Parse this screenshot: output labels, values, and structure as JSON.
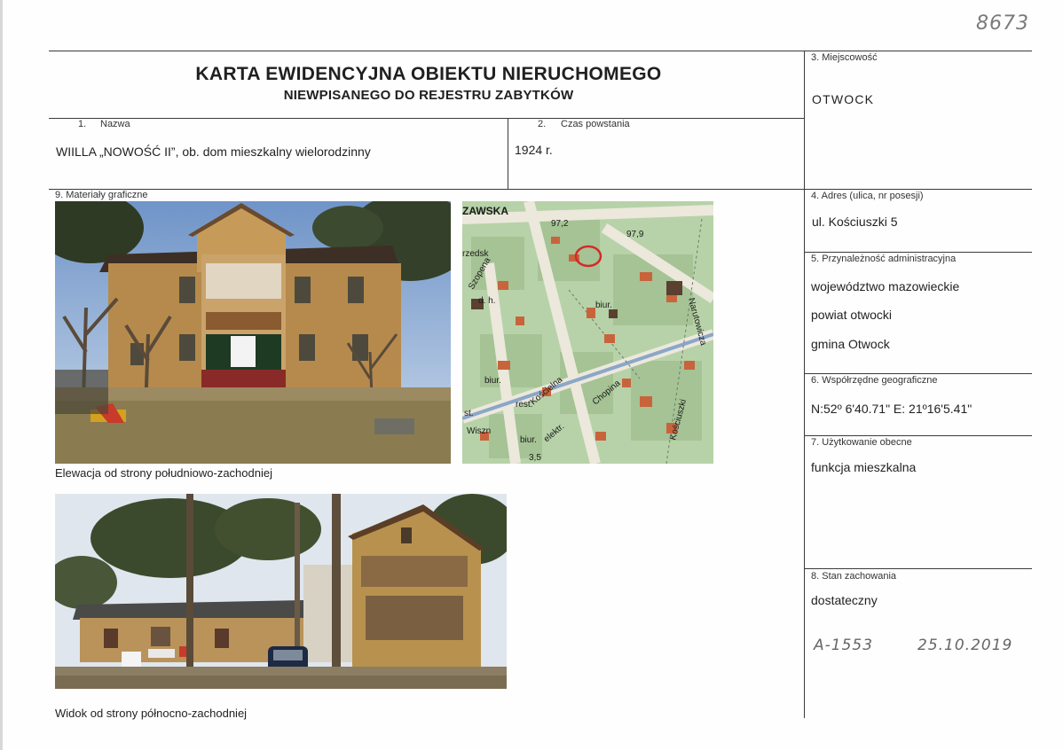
{
  "document": {
    "inventory_number": "8673",
    "title_line1": "KARTA EWIDENCYJNA OBIEKTU NIERUCHOMEGO",
    "title_line2": "NIEWPISANEGO DO REJESTRU ZABYTKÓW"
  },
  "fields": {
    "name": {
      "label": "Nazwa",
      "number": "1.",
      "value": "WIILLA „NOWOŚĆ II”, ob. dom mieszkalny wielorodzinny"
    },
    "created": {
      "label": "Czas powstania",
      "number": "2.",
      "value": "1924 r."
    },
    "locality": {
      "label": "3. Miejscowość",
      "value": "OTWOCK"
    },
    "address": {
      "label": "4. Adres (ulica, nr posesji)",
      "value": "ul. Kościuszki 5"
    },
    "admin": {
      "label": "5. Przynależność administracyjna",
      "voivodeship": "województwo mazowieckie",
      "county": "powiat otwocki",
      "commune": "gmina Otwock"
    },
    "coords": {
      "label": "6. Współrzędne geograficzne",
      "value": "N:52º 6'40.71\" E: 21º16'5.41\""
    },
    "usage": {
      "label": "7. Użytkowanie obecne",
      "value": "funkcja mieszkalna"
    },
    "condition": {
      "label": "8. Stan zachowania",
      "value": "dostateczny"
    },
    "graphics": {
      "label": "9. Materiały graficzne"
    }
  },
  "captions": {
    "photo1": "Elewacja od strony południowo-zachodniej",
    "photo2": "Widok od strony północno-zachodniej"
  },
  "map": {
    "labels": [
      "ZAWSKA",
      "97,2",
      "97,9",
      "rzedsk",
      "Szopena",
      "d. h.",
      "biur.",
      "Kościelna",
      "Chopina",
      "biur.",
      "Kościuszki",
      "rest.",
      "biur.",
      "elektr.",
      "3,5",
      "st.",
      "Wiszn",
      "Narutowicza"
    ]
  },
  "handwritten": {
    "reg_number": "A-1553",
    "date": "25.10.2019"
  },
  "colors": {
    "lines": "#3a3a3a",
    "map_green": "#a9c89a",
    "map_road": "#e9e4d8",
    "map_building": "#c8643c"
  }
}
